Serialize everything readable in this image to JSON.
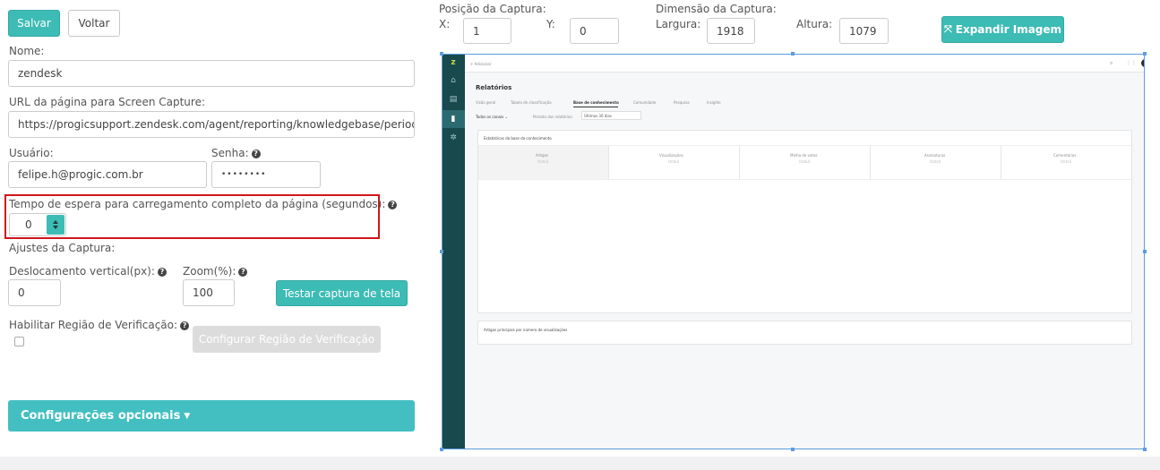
{
  "toolbar": {
    "save_label": "Salvar",
    "back_label": "Voltar"
  },
  "form": {
    "name_label": "Nome:",
    "name_value": "zendesk",
    "url_label": "URL da página para Screen Capture:",
    "url_value": "https://progicsupport.zendesk.com/agent/reporting/knowledgebase/period:",
    "user_label": "Usuário:",
    "user_value": "felipe.h@progic.com.br",
    "password_label": "Senha:",
    "password_value": "••••••••",
    "wait_label": "Tempo de espera para carregamento completo da página (segundos):",
    "wait_value": "0",
    "capture_settings_label": "Ajustes da Captura:",
    "vertical_offset_label": "Deslocamento vertical(px):",
    "vertical_offset_value": "0",
    "zoom_label": "Zoom(%):",
    "zoom_value": "100",
    "test_capture_label": "Testar captura de tela",
    "verify_region_label": "Habilitar Região de Verificação:",
    "configure_region_label": "Configurar Região de Verificação",
    "optional_settings_label": "Configurações opcionais"
  },
  "capture": {
    "position_label": "Posição da Captura:",
    "x_label": "X:",
    "x_value": "1",
    "y_label": "Y:",
    "y_value": "0",
    "dimension_label": "Dimensão da Captura:",
    "width_label": "Largura:",
    "width_value": "1918",
    "height_label": "Altura:",
    "height_value": "1079",
    "expand_label": "Expandir Imagem"
  },
  "preview": {
    "add_label": "+ Adicionar",
    "title": "Relatórios",
    "tabs": [
      "Visão geral",
      "Tabela de classificação",
      "Base de conhecimento",
      "Comunidade",
      "Pesquisa",
      "Insights"
    ],
    "filter_channels": "Todos os canais ⌄",
    "filter_period_label": "Período dos relatórios:",
    "filter_period_value": "Últimos 30 dias",
    "stats_title": "Estatísticas da base de conhecimento",
    "columns": [
      {
        "name": "Artigos",
        "sub": "(total)"
      },
      {
        "name": "Visualizações",
        "sub": "(total)"
      },
      {
        "name": "Média de votos",
        "sub": "(total)"
      },
      {
        "name": "Assinaturas",
        "sub": "(total)"
      },
      {
        "name": "Comentários",
        "sub": "(total)"
      }
    ],
    "top_articles_title": "Artigos principais por número de visualizações"
  },
  "colors": {
    "accent": "#3dbbb5",
    "highlight": "#d0161c",
    "selection": "#5c9ce0",
    "zendesk_sidebar": "#17494d"
  }
}
